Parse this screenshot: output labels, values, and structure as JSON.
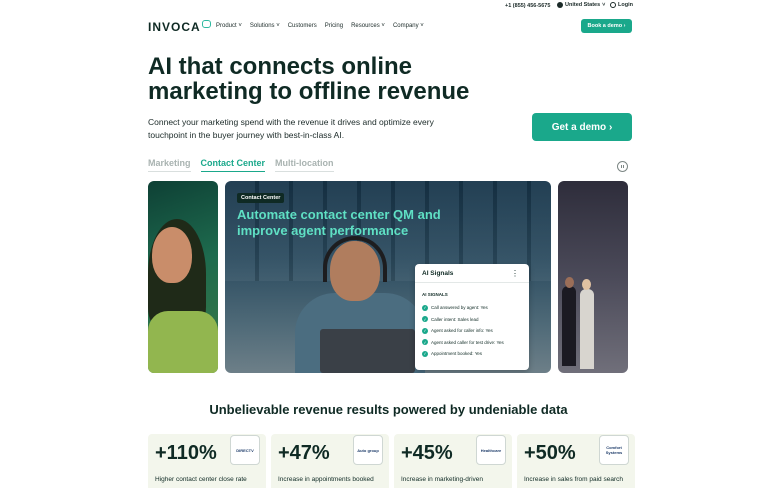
{
  "util": {
    "phone": "+1 (855) 456-5675",
    "locale": "United States",
    "login": "Login"
  },
  "nav": {
    "logo": "INVOCA",
    "menu": [
      "Product",
      "Solutions",
      "Customers",
      "Pricing",
      "Resources",
      "Company"
    ],
    "demo_button": "Book a demo"
  },
  "hero": {
    "title_line1": "AI that connects online",
    "title_line2": "marketing to offline revenue",
    "subtitle_line1": "Connect your marketing spend with the revenue it drives and optimize every",
    "subtitle_line2": "touchpoint in the buyer journey with best-in-class AI.",
    "cta": "Get a demo"
  },
  "tabs": [
    {
      "label": "Marketing",
      "active": false
    },
    {
      "label": "Contact Center",
      "active": true
    },
    {
      "label": "Multi-location",
      "active": false
    }
  ],
  "slide": {
    "badge": "Contact Center",
    "title_line1": "Automate contact center QM and",
    "title_line2": "improve agent performance",
    "signals": {
      "header": "AI Signals",
      "section": "AI SIGNALS",
      "items": [
        "Call answered by agent: Yes",
        "Caller intent: Sales lead",
        "Agent asked for caller info: Yes",
        "Agent asked caller for test drive: Yes",
        "Appointment booked: Yes"
      ]
    }
  },
  "results": {
    "title": "Unbelievable revenue results powered by undeniable data",
    "stats": [
      {
        "value": "+110%",
        "caption": "Higher contact center close rate",
        "logo": "DIRECTV"
      },
      {
        "value": "+47%",
        "caption": "Increase in appointments booked",
        "logo": "Auto group"
      },
      {
        "value": "+45%",
        "caption": "Increase in marketing-driven",
        "logo": "Healthcare"
      },
      {
        "value": "+50%",
        "caption": "Increase in sales from paid search",
        "logo": "Comfort Systems"
      }
    ]
  },
  "colors": {
    "accent": "#1aa88b",
    "text": "#0f2a24",
    "highlight": "#5fe0c4"
  }
}
